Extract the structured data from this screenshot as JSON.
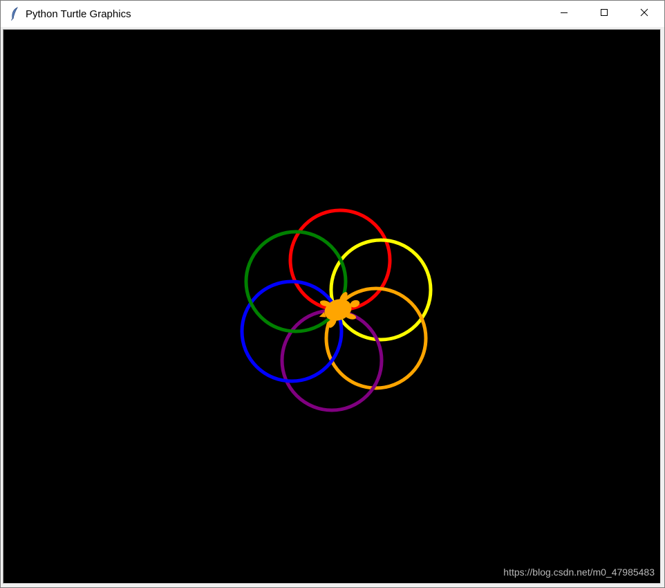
{
  "window": {
    "title": "Python Turtle Graphics",
    "app_icon": "feather-icon",
    "controls": {
      "minimize_icon": "minimize-icon",
      "maximize_icon": "maximize-icon",
      "close_icon": "close-icon"
    }
  },
  "canvas": {
    "background": "#000000",
    "circles": [
      {
        "name": "circle-red",
        "color": "#ff0000"
      },
      {
        "name": "circle-yellow",
        "color": "#ffff00"
      },
      {
        "name": "circle-orange",
        "color": "#ffa500"
      },
      {
        "name": "circle-purple",
        "color": "#800080"
      },
      {
        "name": "circle-blue",
        "color": "#0000ff"
      },
      {
        "name": "circle-green",
        "color": "#008000"
      }
    ],
    "turtle": {
      "color": "#ffa500",
      "shape": "turtle-icon"
    }
  },
  "watermark": "https://blog.csdn.net/m0_47985483"
}
